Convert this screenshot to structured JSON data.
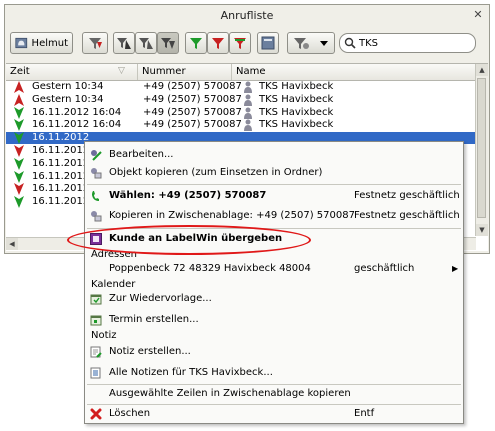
{
  "window": {
    "title": "Anrufliste",
    "close_glyph": "✕"
  },
  "toolbar": {
    "user_button_label": "Helmut",
    "search_value": "TKS",
    "icons": [
      "user-phone-icon",
      "missed-call-filter-icon",
      "filter-all-icon",
      "filter-outgoing-icon",
      "filter-incoming-icon",
      "filter-green-icon",
      "filter-red-icon",
      "filter-mixed-icon",
      "phone-book-icon",
      "dial-dropdown-icon",
      "search-icon"
    ]
  },
  "grid": {
    "columns": [
      "Zeit",
      "Nummer",
      "Name"
    ],
    "rows": [
      {
        "time": "Gestern 10:34",
        "number": "+49 (2507) 570087",
        "name": "TKS Havixbeck",
        "dir": "out-red",
        "selected": false
      },
      {
        "time": "Gestern 10:34",
        "number": "+49 (2507) 570087",
        "name": "TKS Havixbeck",
        "dir": "out-red",
        "selected": false
      },
      {
        "time": "16.11.2012 16:04",
        "number": "+49 (2507) 570087",
        "name": "TKS Havixbeck",
        "dir": "in-green",
        "selected": false
      },
      {
        "time": "16.11.2012 16:04",
        "number": "+49 (2507) 570087",
        "name": "TKS Havixbeck",
        "dir": "in-green",
        "selected": false
      },
      {
        "time": "16.11.2012",
        "number": "",
        "name": "",
        "dir": "in-green",
        "selected": true
      },
      {
        "time": "16.11.2012",
        "number": "",
        "name": "",
        "dir": "in-red",
        "selected": false
      },
      {
        "time": "16.11.2012",
        "number": "",
        "name": "",
        "dir": "in-green",
        "selected": false
      },
      {
        "time": "16.11.2012",
        "number": "",
        "name": "",
        "dir": "in-green",
        "selected": false
      },
      {
        "time": "16.11.2012",
        "number": "",
        "name": "",
        "dir": "in-red",
        "selected": false
      },
      {
        "time": "16.11.2012",
        "number": "",
        "name": "",
        "dir": "in-green",
        "selected": false
      }
    ]
  },
  "menu": {
    "edit": "Bearbeiten...",
    "copy_object": "Objekt kopieren (zum Einsetzen in Ordner)",
    "dial": "Wählen: +49 (2507) 570087",
    "dial_right": "Festnetz geschäftlich",
    "copy_clipboard": "Kopieren in Zwischenablage: +49 (2507) 570087",
    "copy_clipboard_right": "Festnetz geschäftlich",
    "labelwin": "Kunde an LabelWin übergeben",
    "section_addresses": "Adressen",
    "address": "Poppenbeck 72 48329 Havixbeck 48004",
    "address_right": "geschäftlich",
    "section_calendar": "Kalender",
    "followup": "Zur Wiedervorlage...",
    "appointment": "Termin erstellen...",
    "section_note": "Notiz",
    "create_note": "Notiz erstellen...",
    "all_notes": "Alle Notizen für TKS Havixbeck...",
    "copy_rows": "Ausgewählte Zeilen in Zwischenablage kopieren",
    "delete": "Löschen",
    "delete_shortcut": "Entf"
  },
  "colors": {
    "selection": "#3169c6",
    "highlight_ellipse": "#e01818",
    "call_in": "#1d9a2a",
    "call_out": "#c72222"
  }
}
